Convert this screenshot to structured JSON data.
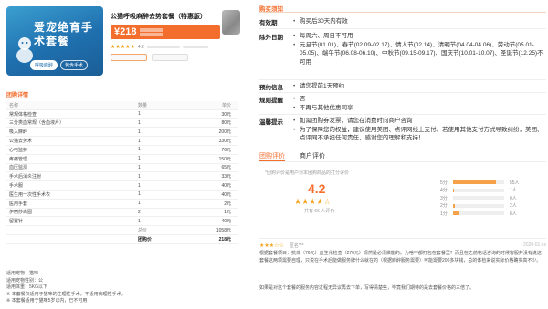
{
  "product": {
    "image_title": "爱宠绝育手术套餐",
    "image_tags": [
      "呼吸麻醉",
      "包含手术"
    ],
    "title": "公猫呼吸麻醉去势套餐（特惠版）",
    "price": "¥218",
    "rating_stars": "★★★★★",
    "rating_value": "4.2"
  },
  "details": {
    "section_title": "团购详情",
    "columns": [
      "名称",
      "数量",
      "单价"
    ],
    "rows": [
      {
        "name": "常规体格检查",
        "qty": "1",
        "price": "30元"
      },
      {
        "name": "三分类血常规（含血液片）",
        "qty": "1",
        "price": "80元"
      },
      {
        "name": "吸入麻醉",
        "qty": "1",
        "price": "200元"
      },
      {
        "name": "公猫去势术",
        "qty": "1",
        "price": "330元"
      },
      {
        "name": "心电监护",
        "qty": "1",
        "price": "76元"
      },
      {
        "name": "疼痛管理",
        "qty": "1",
        "price": "150元"
      },
      {
        "name": "血压监测",
        "qty": "1",
        "price": "65元"
      },
      {
        "name": "手术后消炎注射",
        "qty": "1",
        "price": "33元"
      },
      {
        "name": "手术服",
        "qty": "1",
        "price": "40元"
      },
      {
        "name": "医生用一次性手术衣",
        "qty": "1",
        "price": "40元"
      },
      {
        "name": "医用手套",
        "qty": "1",
        "price": "2元"
      },
      {
        "name": "伊丽莎白圈",
        "qty": "2",
        "price": "1元"
      },
      {
        "name": "留置针",
        "qty": "1",
        "price": "40元"
      }
    ],
    "total_label": "总价",
    "total_value": "1058元",
    "group_label": "团购价",
    "group_value": "218元"
  },
  "notes": [
    "适用宠物：猫咪",
    "适用宠物性别：公",
    "适用体重：5KG以下",
    "※ 本套餐仅适用于猫咪的生理性手术，不适用病理性手术。",
    "※ 本套餐适用于猫咪5岁以内，已不可用"
  ],
  "purchase": {
    "section_title": "购买须知",
    "blocks": [
      {
        "label": "有效期",
        "items": [
          "购买后30天内有效"
        ]
      },
      {
        "label": "除外日期",
        "items": [
          "每周六、周日不可用",
          "元旦节(01.01)、春节(02.09-02.17)、情人节(02.14)、清明节(04.04-04.06)、劳动节(05.01-05.05)、端午节(06.08-06.10)、中秋节(09.15-09.17)、国庆节(10.01-10.07)、圣诞节(12.25)不可用"
        ]
      },
      {
        "label": "预约信息",
        "items": [
          "请您提前1天预约"
        ]
      },
      {
        "label": "规则提醒",
        "items": [
          "否",
          "不再与其他优惠同享"
        ]
      },
      {
        "label": "温馨提示",
        "items": [
          "如需团购券发票，请您在消费时向商户咨询",
          "为了保障您的权益，建议使用美团、点评网线上支付。若使用其他支付方式导致纠纷，美团、点评网不承担任何责任，感谢您的理解和支持！"
        ]
      }
    ]
  },
  "reviews": {
    "tabs": [
      "团购评价",
      "商户评价"
    ],
    "disclaimer": "*团购评价是用户对本团购商品的打分评价",
    "score": "4.2",
    "stars": "★★★★☆",
    "count_text": "共有 66 人评价",
    "distribution": [
      {
        "label": "5分",
        "count": "55人",
        "fraction": 0.833
      },
      {
        "label": "4分",
        "count": "1人",
        "fraction": 0.015
      },
      {
        "label": "3分",
        "count": "0人",
        "fraction": 0
      },
      {
        "label": "2分",
        "count": "2人",
        "fraction": 0.03
      },
      {
        "label": "1分",
        "count": "8人",
        "fraction": 0.121
      }
    ],
    "item": {
      "stars": "★★★☆☆",
      "user": "匿名***",
      "date": "2020-01-xx",
      "text": "根据套餐项目：抗体（76元）血生化检查（270元）现然是必须做能的。为啥不都打包在套餐里？而且在之前电话咨询的时候客服并没有说这套餐这两项需要自理，只说在手术后能做服务牌什么就在的（根据麻醉服务需要）可能需要200多块钱，总的体检来说实际价格确实高不少。",
      "text2": "如果是对这个套餐的服务内容过程无异议再去下单，写得清楚些，毕竟我们期待的是去套餐价格的三倍了。"
    }
  },
  "colors": {
    "accent": "#f36d2c",
    "star": "#f3a21a"
  }
}
